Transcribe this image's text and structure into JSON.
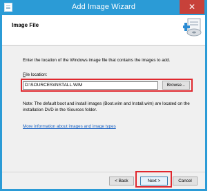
{
  "window": {
    "title": "Add Image Wizard",
    "close_glyph": "✕"
  },
  "header": {
    "title": "Image File"
  },
  "description": "Enter the location of the Windows image file that contains the images to add.",
  "file_location": {
    "label_prefix": "F",
    "label_rest": "ile location:",
    "value": "D:\\SOURCES\\INSTALL.WIM",
    "browse_label": "Browse..."
  },
  "note": "Note: The default boot and install images (Boot.wim and Install.wim) are located on the installation DVD in the \\Sources folder.",
  "more_info_link": "More information about images and image types",
  "buttons": {
    "back": "< Back",
    "next": "Next >",
    "cancel": "Cancel"
  },
  "colors": {
    "titlebar": "#2b9bd6",
    "close": "#c7413a",
    "highlight": "#e0282e",
    "link": "#1a62c3"
  },
  "icons": {
    "app": "document-icon",
    "wizard": "add-image-icon"
  }
}
